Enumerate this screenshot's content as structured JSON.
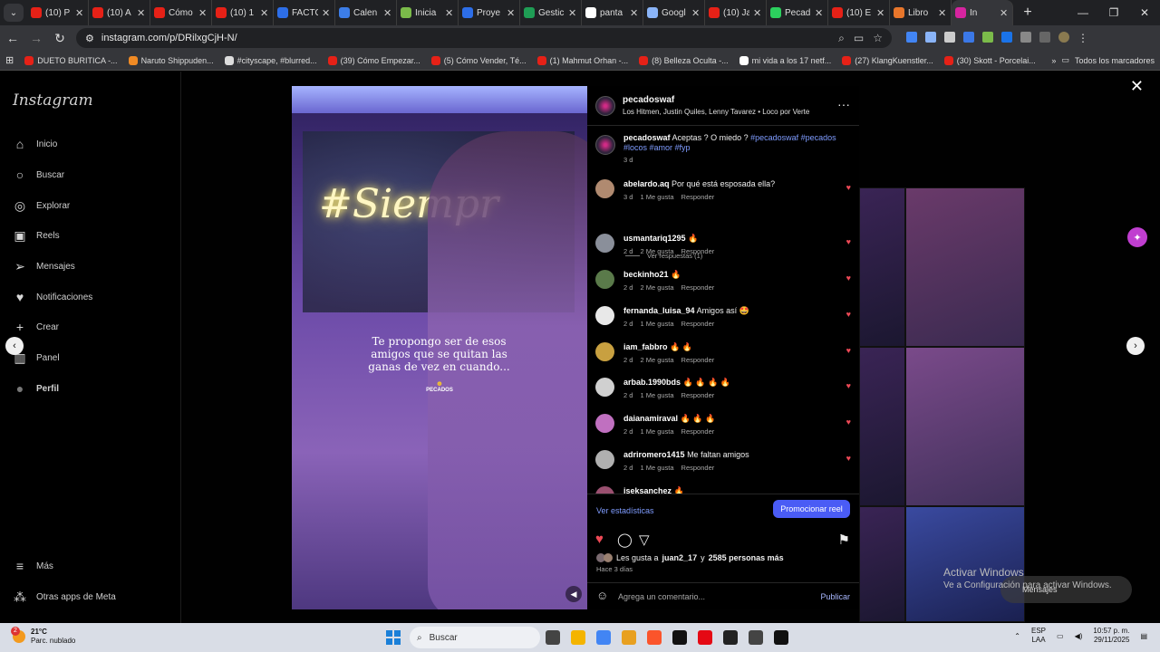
{
  "browser": {
    "tabs": [
      {
        "title": "(10) P",
        "color": "#e62117",
        "active": false
      },
      {
        "title": "(10) A",
        "color": "#e62117",
        "active": false
      },
      {
        "title": "Cómo",
        "color": "#e62117",
        "active": false
      },
      {
        "title": "(10) 1",
        "color": "#e62117",
        "active": false
      },
      {
        "title": "FACTC",
        "color": "#2d6ee8",
        "active": false
      },
      {
        "title": "Calen",
        "color": "#3c7de8",
        "active": false
      },
      {
        "title": "Inicia",
        "color": "#7bbb4a",
        "active": false
      },
      {
        "title": "Proye",
        "color": "#2d6ee8",
        "active": false
      },
      {
        "title": "Gestic",
        "color": "#1f9d55",
        "active": false
      },
      {
        "title": "panta",
        "color": "#ffffff",
        "active": false
      },
      {
        "title": "Googl",
        "color": "#8ab4f8",
        "active": false
      },
      {
        "title": "(10) Ja",
        "color": "#e62117",
        "active": false
      },
      {
        "title": "Pecad",
        "color": "#2cd05e",
        "active": false
      },
      {
        "title": "(10) E",
        "color": "#e62117",
        "active": false
      },
      {
        "title": "Libro",
        "color": "#e8762b",
        "active": false
      },
      {
        "title": "In",
        "color": "#d6249f",
        "active": true
      }
    ],
    "url": "instagram.com/p/DRilxgCjH-N/",
    "bookmarks": [
      {
        "label": "DUETO BURITICA -...",
        "color": "#e62117"
      },
      {
        "label": "Naruto Shippuden...",
        "color": "#f08a24"
      },
      {
        "label": "#cityscape, #blurred...",
        "color": "#dddddd"
      },
      {
        "label": "(39) Cómo Empezar...",
        "color": "#e62117"
      },
      {
        "label": "(5) Cómo Vender, Té...",
        "color": "#e62117"
      },
      {
        "label": "(1) Mahmut Orhan -...",
        "color": "#e62117"
      },
      {
        "label": "(8) Belleza Oculta -...",
        "color": "#e62117"
      },
      {
        "label": "mi vida a los 17 netf...",
        "color": "#ffffff"
      },
      {
        "label": "(27) KlangKuenstler...",
        "color": "#e62117"
      },
      {
        "label": "(30) Skott - Porcelai...",
        "color": "#e62117"
      }
    ],
    "all_bookmarks": "Todos los marcadores"
  },
  "sidebar": {
    "logo": "Instagram",
    "items": [
      {
        "label": "Inicio",
        "icon": "home-icon",
        "glyph": "⌂"
      },
      {
        "label": "Buscar",
        "icon": "search-icon",
        "glyph": "○"
      },
      {
        "label": "Explorar",
        "icon": "explore-icon",
        "glyph": "◎"
      },
      {
        "label": "Reels",
        "icon": "reels-icon",
        "glyph": "▣"
      },
      {
        "label": "Mensajes",
        "icon": "messages-icon",
        "glyph": "➢"
      },
      {
        "label": "Notificaciones",
        "icon": "heart-icon",
        "glyph": "♥"
      },
      {
        "label": "Crear",
        "icon": "create-icon",
        "glyph": "+"
      },
      {
        "label": "Panel",
        "icon": "panel-icon",
        "glyph": "▥"
      },
      {
        "label": "Perfil",
        "icon": "profile-icon",
        "glyph": "●"
      }
    ],
    "more": "Más",
    "meta": "Otras apps de Meta"
  },
  "reel": {
    "neon_text": "#Siempr",
    "caption": "Te propongo ser de esos amigos que se quitan las ganas de vez en cuando...",
    "brand": "PECADOS"
  },
  "post": {
    "username": "pecadoswaf",
    "audio": "Los Hitmen, Justin Quiles, Lenny Tavarez • Loco por Verte",
    "caption_text": "Aceptas ? O miedo ?",
    "caption_tags": "#pecadoswaf #pecados #locos #amor #fyp",
    "caption_time": "3 d",
    "view_replies": "Ver respuestas (1)",
    "comments": [
      {
        "user": "abelardo.aq",
        "text": "Por qué está esposada ella?",
        "time": "3 d",
        "likes": "1 Me gusta",
        "reply": "Responder",
        "color": "#b08a70"
      },
      {
        "user": "usmantariq1295",
        "text": "🔥",
        "time": "2 d",
        "likes": "2 Me gusta",
        "reply": "Responder",
        "color": "#8a8f9a"
      },
      {
        "user": "beckinho21",
        "text": "🔥",
        "time": "2 d",
        "likes": "2 Me gusta",
        "reply": "Responder",
        "color": "#5a7a4a"
      },
      {
        "user": "fernanda_luisa_94",
        "text": "Amigos así 🤩",
        "time": "2 d",
        "likes": "1 Me gusta",
        "reply": "Responder",
        "color": "#e8e8e8"
      },
      {
        "user": "iam_fabbro",
        "text": "🔥 🔥",
        "time": "2 d",
        "likes": "2 Me gusta",
        "reply": "Responder",
        "color": "#c8a040"
      },
      {
        "user": "arbab.1990bds",
        "text": "🔥 🔥 🔥 🔥",
        "time": "2 d",
        "likes": "1 Me gusta",
        "reply": "Responder",
        "color": "#d0d0d0"
      },
      {
        "user": "daianamiraval",
        "text": "🔥 🔥 🔥",
        "time": "2 d",
        "likes": "1 Me gusta",
        "reply": "Responder",
        "color": "#c070c0"
      },
      {
        "user": "adriromero1415",
        "text": "Me faltan amigos",
        "time": "2 d",
        "likes": "1 Me gusta",
        "reply": "Responder",
        "color": "#b0b0b0"
      },
      {
        "user": "iseksanchez",
        "text": "🔥",
        "time": "",
        "likes": "",
        "reply": "",
        "color": "#9a5070"
      }
    ],
    "stats_link": "Ver estadísticas",
    "promote": "Promocionar reel",
    "likes_prefix": "Les gusta a",
    "likes_user": "juan2_17",
    "likes_mid": "y",
    "likes_count": "2585 personas más",
    "posted": "Hace 3 días",
    "comment_placeholder": "Agrega un comentario...",
    "publish": "Publicar"
  },
  "overlay": {
    "watermark_title": "Activar Windows",
    "watermark_sub": "Ve a Configuración para activar Windows.",
    "messages_pill": "Mensajes"
  },
  "taskbar": {
    "temp": "21°C",
    "weather": "Parc. nublado",
    "weather_badge": "2",
    "search": "Buscar",
    "lang1": "ESP",
    "lang2": "LAA",
    "time": "10:57 p. m.",
    "date": "29/11/2025",
    "apps": [
      "#444444",
      "#f4b400",
      "#4285f4",
      "#e8a020",
      "#fb542b",
      "#111111",
      "#e50914",
      "#222222",
      "#444444",
      "#111111"
    ]
  }
}
